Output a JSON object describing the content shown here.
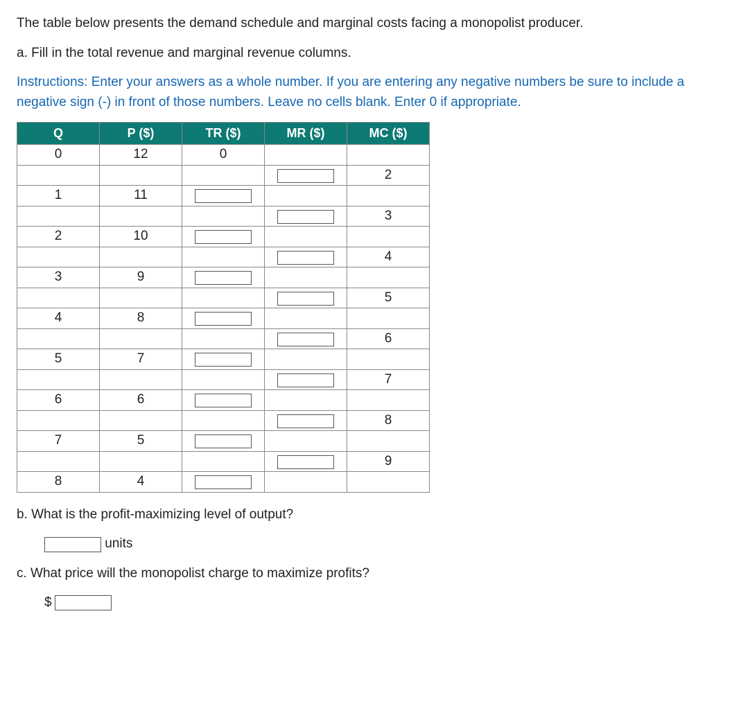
{
  "intro": "The table below presents the demand schedule and marginal costs facing a monopolist producer.",
  "part_a": "a. Fill in the total revenue and marginal revenue columns.",
  "instructions_label": "Instructions",
  "instructions_text": ": Enter your answers as a whole number. If you are entering any negative numbers be sure to include a negative sign (-) in front of those numbers. Leave no cells blank. Enter 0 if appropriate.",
  "headers": {
    "q": "Q",
    "p": "P ($)",
    "tr": "TR ($)",
    "mr": "MR ($)",
    "mc": "MC ($)"
  },
  "rows": {
    "r0": {
      "q": "0",
      "p": "12",
      "tr": "0"
    },
    "r1": {
      "mc": "2"
    },
    "r2": {
      "q": "1",
      "p": "11"
    },
    "r3": {
      "mc": "3"
    },
    "r4": {
      "q": "2",
      "p": "10"
    },
    "r5": {
      "mc": "4"
    },
    "r6": {
      "q": "3",
      "p": "9"
    },
    "r7": {
      "mc": "5"
    },
    "r8": {
      "q": "4",
      "p": "8"
    },
    "r9": {
      "mc": "6"
    },
    "r10": {
      "q": "5",
      "p": "7"
    },
    "r11": {
      "mc": "7"
    },
    "r12": {
      "q": "6",
      "p": "6"
    },
    "r13": {
      "mc": "8"
    },
    "r14": {
      "q": "7",
      "p": "5"
    },
    "r15": {
      "mc": "9"
    },
    "r16": {
      "q": "8",
      "p": "4"
    }
  },
  "part_b": "b. What is the profit-maximizing level of output?",
  "units_label": "units",
  "part_c": "c. What price will the monopolist charge to maximize profits?",
  "dollar": "$"
}
